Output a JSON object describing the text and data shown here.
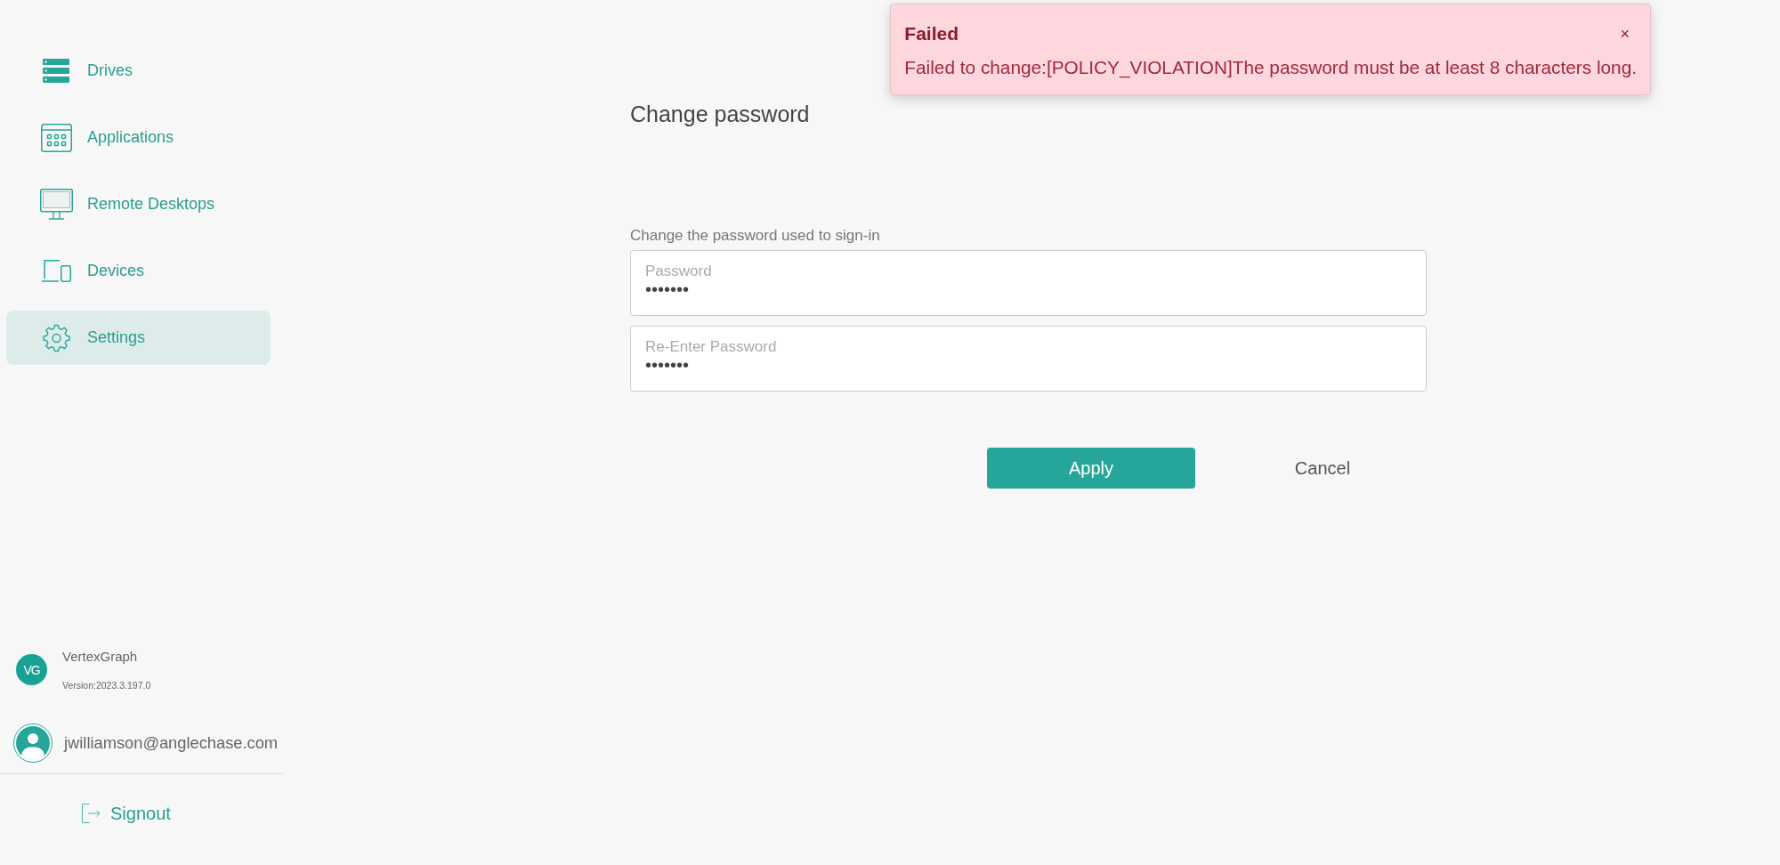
{
  "sidebar": {
    "nav_items": [
      {
        "label": "Drives",
        "selected": false
      },
      {
        "label": "Applications",
        "selected": false
      },
      {
        "label": "Remote Desktops",
        "selected": false
      },
      {
        "label": "Devices",
        "selected": false
      },
      {
        "label": "Settings",
        "selected": true
      }
    ],
    "product": {
      "logo_text": "VG",
      "name": "VertexGraph",
      "version": "Version:2023.3.197.0"
    },
    "user": {
      "email": "jwilliamson@anglechase.com"
    },
    "signout": {
      "label": "Signout"
    }
  },
  "main": {
    "title": "Change password",
    "section_label": "Change the password used to sign-in",
    "fields": [
      {
        "label": "Password",
        "value": "•••••••"
      },
      {
        "label": "Re-Enter Password",
        "value": "•••••••"
      }
    ],
    "buttons": [
      {
        "label": "Apply",
        "kind": "primary"
      },
      {
        "label": "Cancel",
        "kind": "text"
      }
    ]
  },
  "toast": {
    "title": "Failed",
    "message": "Failed to change:[POLICY_VIOLATION]The password must be at least 8 characters long.",
    "close": "×"
  }
}
